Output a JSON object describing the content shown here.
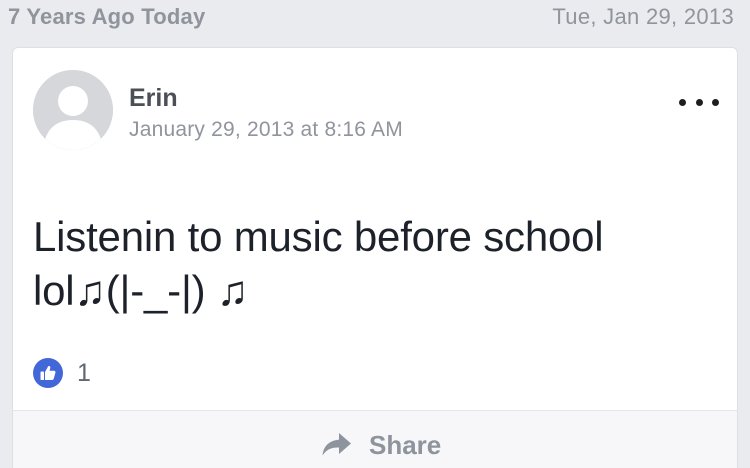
{
  "memory": {
    "title": "7 Years Ago Today",
    "date": "Tue, Jan 29, 2013"
  },
  "post": {
    "author": "Erin",
    "timestamp": "January 29, 2013 at 8:16 AM",
    "text_line1": "Listenin to music before school",
    "text_line2": "lol♫(|-_-|) ♫",
    "like_count": "1",
    "more_icon": "more-options-icon",
    "avatar_icon": "default-profile-avatar"
  },
  "actions": {
    "share_label": "Share",
    "share_icon": "share-arrow-icon"
  },
  "colors": {
    "background": "#e9ebee",
    "card": "#ffffff",
    "muted_text": "#90949c",
    "like_blue": "#4267d8"
  }
}
